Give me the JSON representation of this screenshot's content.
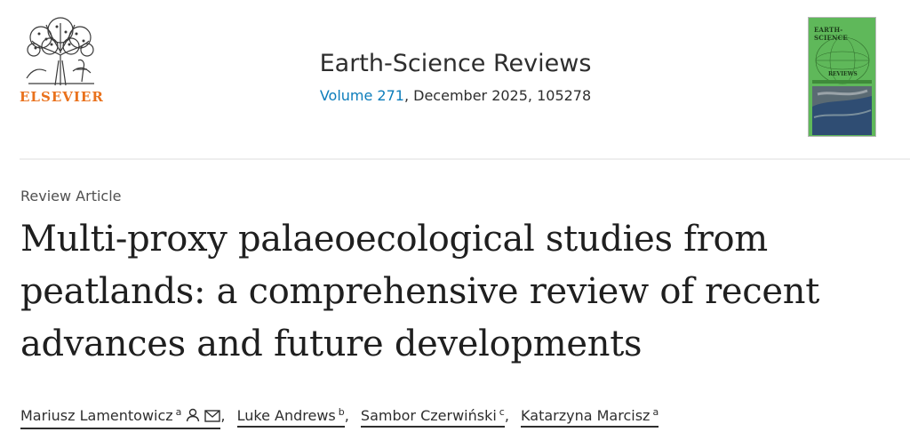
{
  "publisher": {
    "logo_icon": "elsevier-tree-logo",
    "wordmark": "ELSEVIER",
    "wordmark_color": "#e9711c"
  },
  "journal": {
    "title": "Earth-Science Reviews",
    "volume_link": "Volume 271",
    "issue_rest": ", December 2025, 105278",
    "link_color": "#0c7dbb"
  },
  "cover": {
    "journal_name": "EARTH-SCIENCE",
    "sub": "REVIEWS",
    "background": "#5fb85a"
  },
  "article": {
    "type": "Review Article",
    "title": "Multi-proxy palaeoecological studies from peatlands: a comprehensive review of recent advances and future developments"
  },
  "authors": [
    {
      "name": "Mariusz Lamentowicz",
      "affiliation": "a",
      "icons": [
        "person-icon",
        "envelope-icon"
      ]
    },
    {
      "name": "Luke Andrews",
      "affiliation": "b"
    },
    {
      "name": "Sambor Czerwiński",
      "affiliation": "c"
    },
    {
      "name": "Katarzyna Marcisz",
      "affiliation": "a"
    }
  ],
  "author_separator": ","
}
